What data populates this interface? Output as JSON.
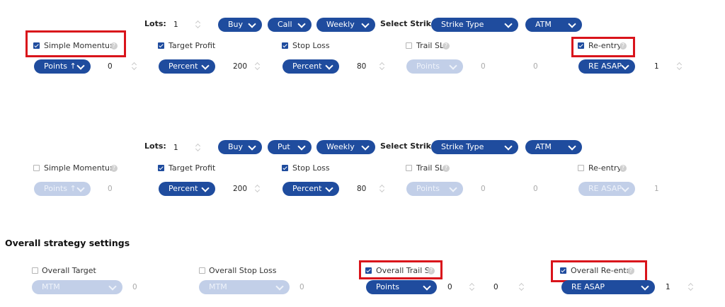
{
  "leg1": {
    "lots_label": "Lots:",
    "lots_value": "1",
    "side": "Buy",
    "option_type": "Call",
    "expiry": "Weekly",
    "select_strike_label": "Select Strike",
    "strike_type": "Strike Type",
    "strike": "ATM",
    "simple_momentum_label": "Simple Momentum",
    "momentum_mode": "Points ↑",
    "momentum_value": "0",
    "target_profit_label": "Target Profit",
    "target_mode": "Percent",
    "target_value": "200",
    "stop_loss_label": "Stop Loss",
    "stop_loss_mode": "Percent",
    "stop_loss_value": "80",
    "trail_sl_label": "Trail SL",
    "trail_mode": "Points",
    "trail_value_1": "0",
    "trail_value_2": "0",
    "reentry_label": "Re-entry",
    "reentry_mode": "RE ASAP",
    "reentry_value": "1"
  },
  "leg2": {
    "lots_label": "Lots:",
    "lots_value": "1",
    "side": "Buy",
    "option_type": "Put",
    "expiry": "Weekly",
    "select_strike_label": "Select Strike",
    "strike_type": "Strike Type",
    "strike": "ATM",
    "simple_momentum_label": "Simple Momentum",
    "momentum_mode": "Points ↑",
    "momentum_value": "0",
    "target_profit_label": "Target Profit",
    "target_mode": "Percent",
    "target_value": "200",
    "stop_loss_label": "Stop Loss",
    "stop_loss_mode": "Percent",
    "stop_loss_value": "80",
    "trail_sl_label": "Trail SL",
    "trail_mode": "Points",
    "trail_value_1": "0",
    "trail_value_2": "0",
    "reentry_label": "Re-entry",
    "reentry_mode": "RE ASAP",
    "reentry_value": "1"
  },
  "overall": {
    "title": "Overall strategy settings",
    "target_label": "Overall Target",
    "target_mode": "MTM",
    "target_value": "0",
    "stop_loss_label": "Overall Stop Loss",
    "stop_loss_mode": "MTM",
    "stop_loss_value": "0",
    "trail_sl_label": "Overall Trail SL",
    "trail_mode": "Points",
    "trail_value_1": "0",
    "trail_value_2": "0",
    "reentry_label": "Overall Re-entry",
    "reentry_mode": "RE ASAP",
    "reentry_value": "1"
  },
  "colors": {
    "pill_active": "#1f4c9e",
    "pill_disabled": "#c2cfe8",
    "highlight": "#d9141b"
  }
}
